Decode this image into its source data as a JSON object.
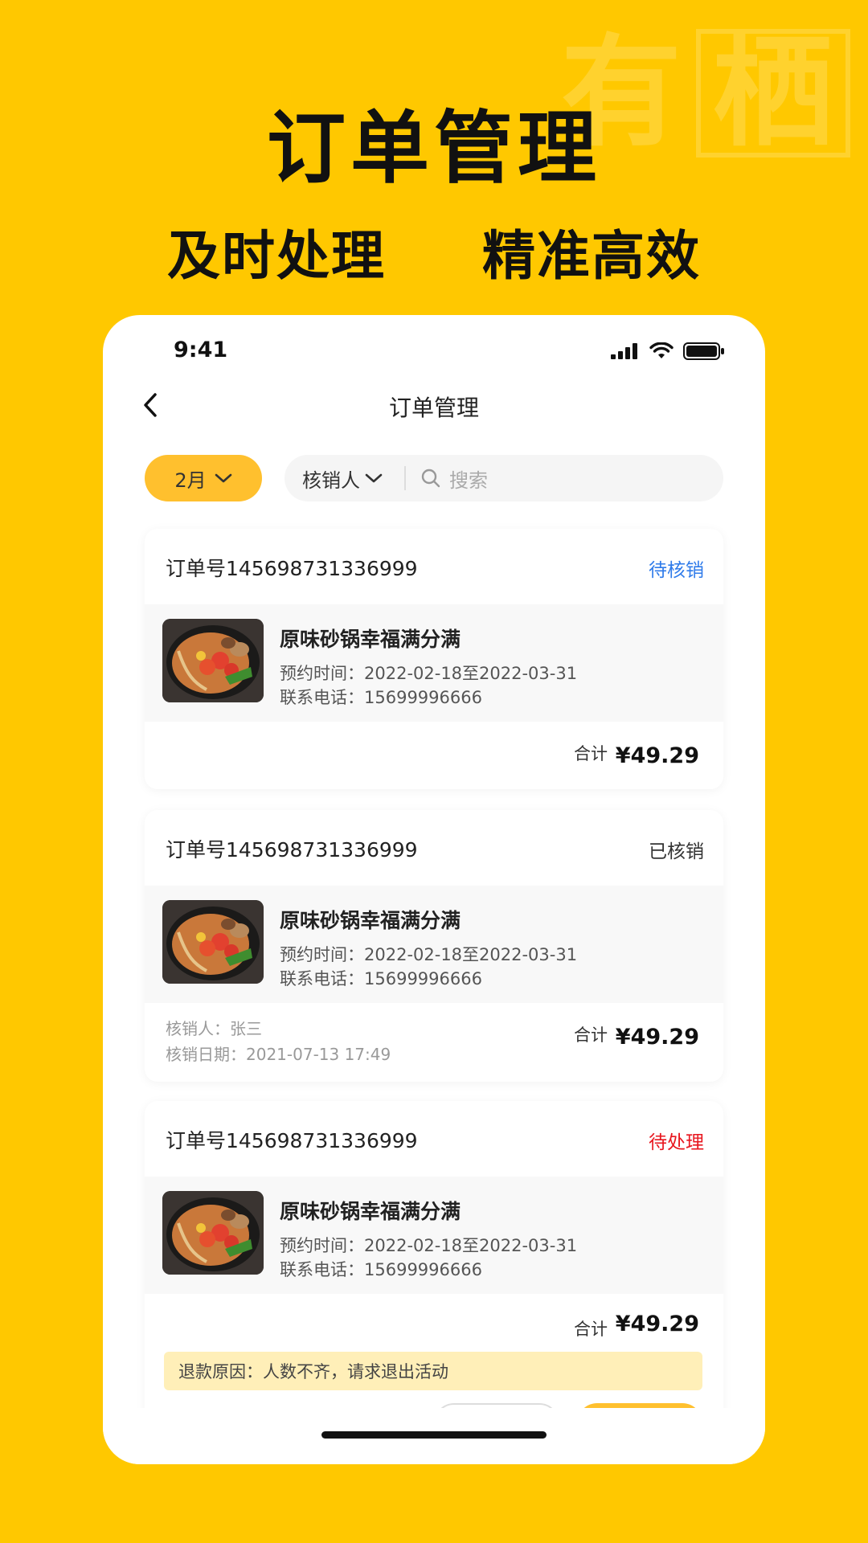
{
  "promo": {
    "watermark_char_1": "有",
    "watermark_char_2": "栖",
    "headline": "订单管理",
    "subline_left": "及时处理",
    "subline_right": "精准高效"
  },
  "status_bar": {
    "time": "9:41",
    "icons": [
      "signal-icon",
      "wifi-icon",
      "battery-icon"
    ]
  },
  "nav": {
    "title": "订单管理",
    "back_icon": "chevron-left-icon"
  },
  "filters": {
    "month": "2月",
    "verifier": "核销人",
    "search_placeholder": "搜索"
  },
  "orders": [
    {
      "order_no": "订单号145698731336999",
      "status": "待核销",
      "status_color": "#2F7BEA",
      "product_name": "原味砂锅幸福满分满",
      "booking_time": "预约时间：2022-02-18至2022-03-31",
      "phone": "联系电话：15699996666",
      "total_label": "合计",
      "total_price": "¥49.29"
    },
    {
      "order_no": "订单号145698731336999",
      "status": "已核销",
      "status_color": "#333333",
      "product_name": "原味砂锅幸福满分满",
      "booking_time": "预约时间：2022-02-18至2022-03-31",
      "phone": "联系电话：15699996666",
      "verifier": "核销人：张三",
      "verify_date": "核销日期：2021-07-13   17:49",
      "total_label": "合计",
      "total_price": "¥49.29"
    },
    {
      "order_no": "订单号145698731336999",
      "status": "待处理",
      "status_color": "#E8161E",
      "product_name": "原味砂锅幸福满分满",
      "booking_time": "预约时间：2022-02-18至2022-03-31",
      "phone": "联系电话：15699996666",
      "total_label": "合计",
      "total_price": "¥49.29",
      "refund_reason": "退款原因：人数不齐，请求退出活动"
    }
  ]
}
